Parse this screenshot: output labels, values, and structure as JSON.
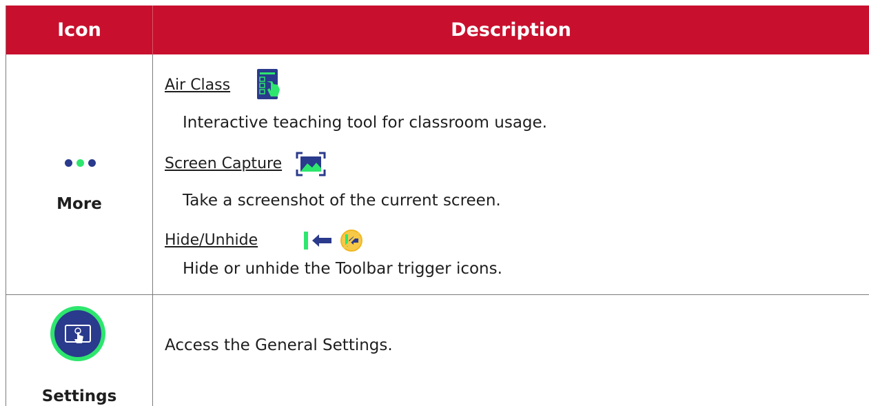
{
  "header": {
    "col_icon": "Icon",
    "col_description": "Description",
    "bg_color": "#c8102e"
  },
  "more": {
    "label": "More",
    "dot_colors": [
      "#2a3a8c",
      "#2ee66e",
      "#2a3a8c"
    ],
    "items": [
      {
        "title": "Air Class",
        "icon": "air-class-icon",
        "description": "Interactive teaching tool for classroom usage."
      },
      {
        "title": "Screen Capture",
        "icon": "screen-capture-icon",
        "description": "Take a screenshot of the current screen."
      },
      {
        "title": "Hide/Unhide",
        "icon": "hide-unhide-icons",
        "description": "Hide or unhide the Toolbar trigger icons."
      }
    ]
  },
  "settings": {
    "label": "Settings",
    "icon": "settings-touch-icon",
    "description": "Access the General Settings."
  }
}
